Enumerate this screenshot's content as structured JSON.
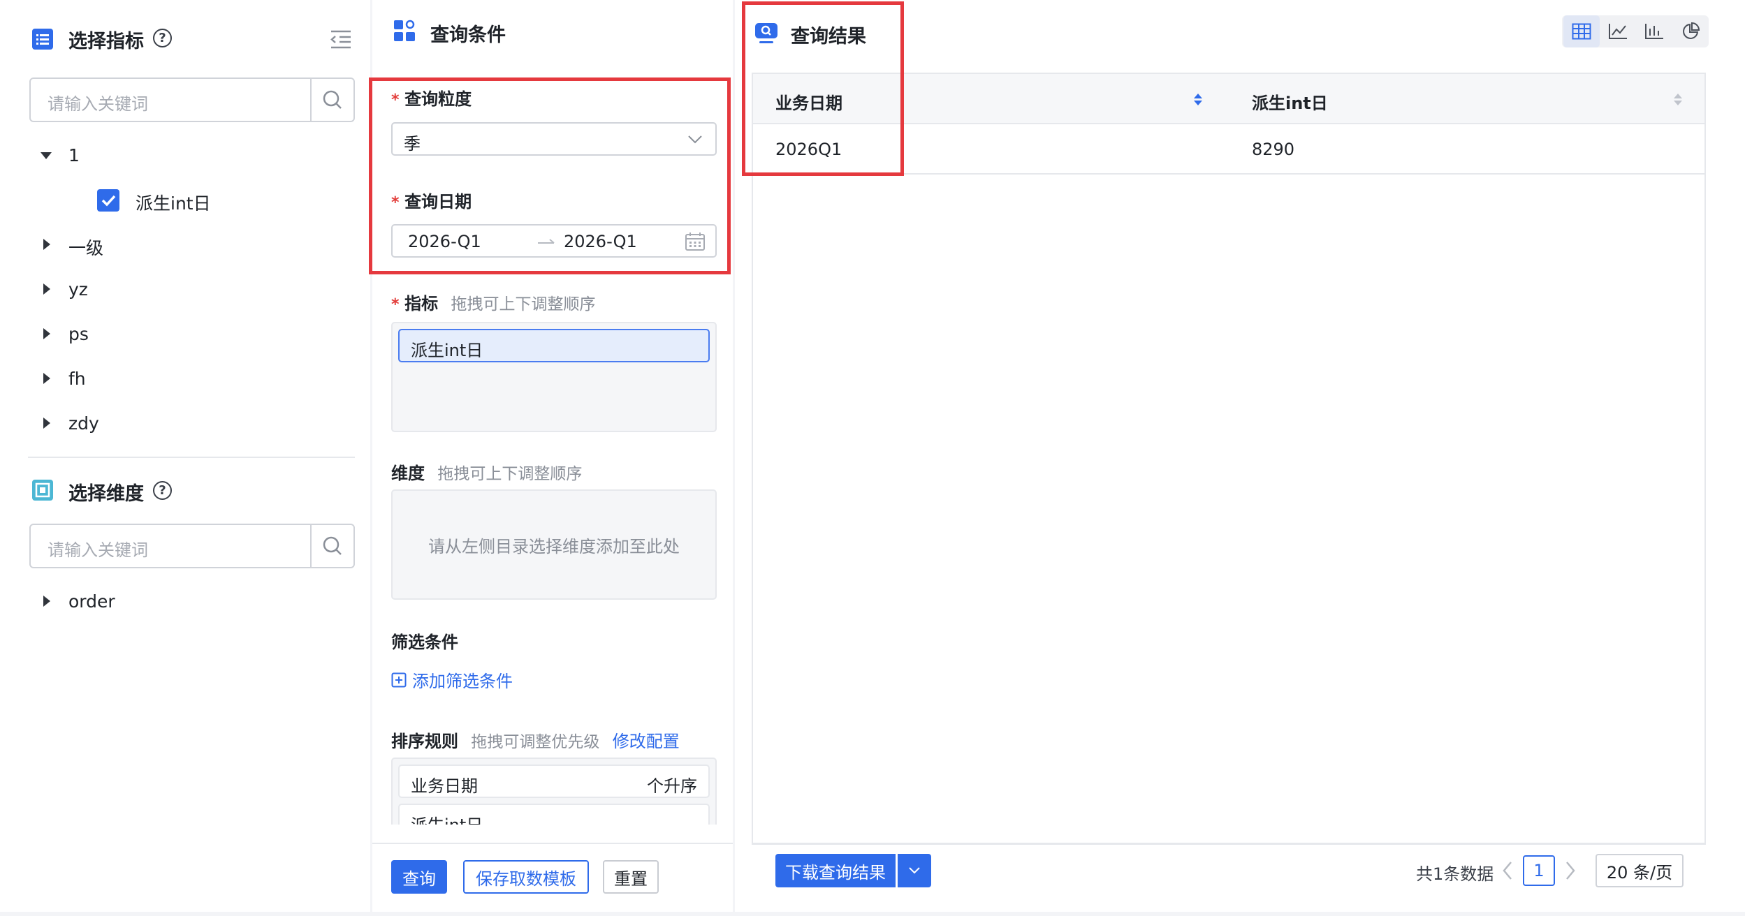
{
  "left": {
    "metrics_title": "选择指标",
    "metrics_search_placeholder": "请输入关键词",
    "metric_tree": {
      "group_1": "1",
      "metric_leaf": "派生int日",
      "collapsed_groups": [
        "一级",
        "yz",
        "ps",
        "fh",
        "zdy"
      ]
    },
    "dimensions_title": "选择维度",
    "dimensions_search_placeholder": "请输入关键词",
    "dimension_tree": [
      "order"
    ]
  },
  "middle": {
    "title": "查询条件",
    "granularity_label": "查询粒度",
    "granularity_value": "季",
    "date_label": "查询日期",
    "date_start": "2026-Q1",
    "date_end": "2026-Q1",
    "metric_label": "指标",
    "metric_hint": "拖拽可上下调整顺序",
    "selected_metric": "派生int日",
    "dimension_label": "维度",
    "dimension_hint": "拖拽可上下调整顺序",
    "dimension_placeholder": "请从左侧目录选择维度添加至此处",
    "filter_label": "筛选条件",
    "add_filter": "添加筛选条件",
    "sort_label": "排序规则",
    "sort_hint": "拖拽可调整优先级",
    "sort_edit": "修改配置",
    "sort_rules": [
      {
        "field": "业务日期",
        "order": "个升序"
      },
      {
        "field": "派生int日",
        "order": ""
      }
    ],
    "buttons": {
      "query": "查询",
      "save_template": "保存取数模板",
      "reset": "重置"
    }
  },
  "right": {
    "title": "查询结果",
    "view_icons": [
      "table-icon",
      "line-chart-icon",
      "bar-chart-icon",
      "pie-chart-icon"
    ],
    "table": {
      "columns": [
        "业务日期",
        "派生int日"
      ],
      "rows": [
        [
          "2026Q1",
          "8290"
        ]
      ]
    },
    "download_button": "下载查询结果",
    "pagination": {
      "total": "共1条数据",
      "current_page": "1",
      "page_size": "20 条/页"
    }
  },
  "colors": {
    "accent": "#2f6bea",
    "highlight_box": "#e5393e"
  }
}
